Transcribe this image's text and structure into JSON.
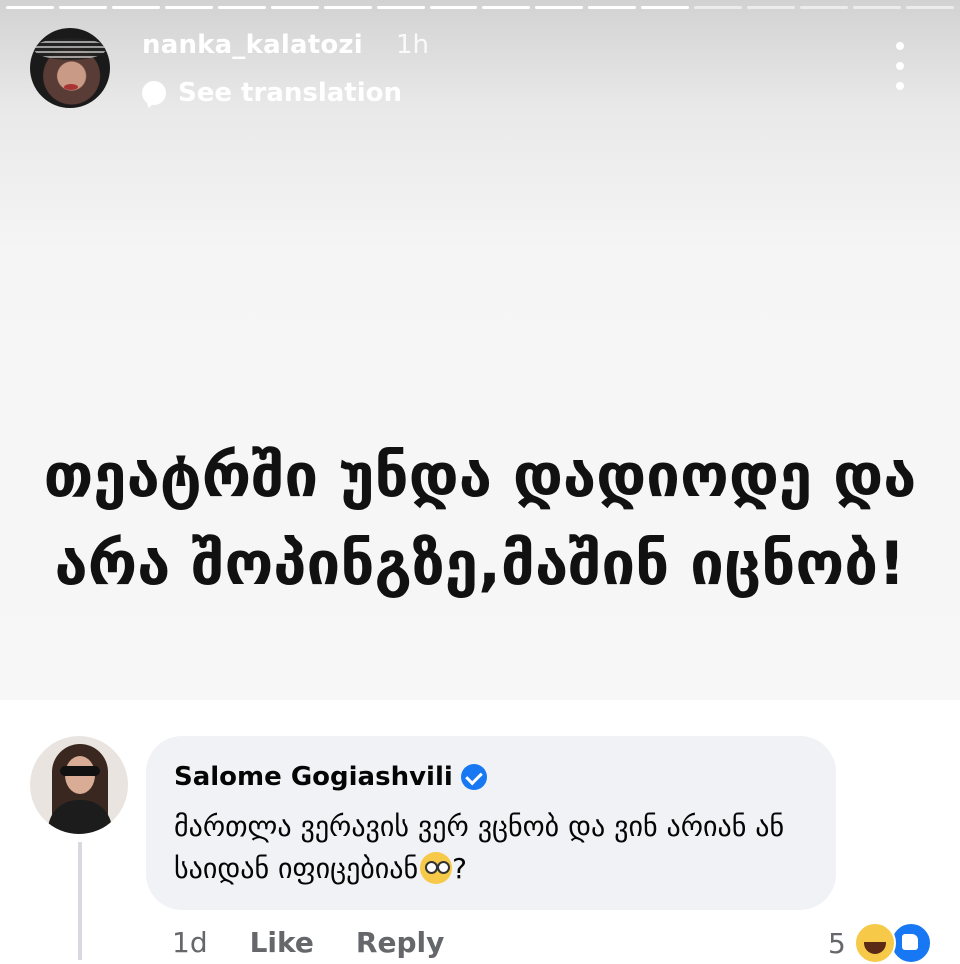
{
  "story": {
    "progress_segments": 18,
    "progress_done": 13,
    "username": "nanka_kalatozi",
    "time": "1h",
    "translate_icon": "speech-bubble-icon",
    "translate_label": "See translation",
    "menu_icon": "more-vertical-icon",
    "text": "თეატრში უნდა დადიოდე და არა შოპინგზე,მაშინ იცნობ!"
  },
  "comment": {
    "author": "Salome Gogiashvili",
    "verified": true,
    "verified_icon": "verified-badge-icon",
    "text": "მართლა ვერავის ვერ ვცნობ და ვინ არიან ან საიდან იფიცებიან",
    "emoji": "flushed-face-icon",
    "text_suffix": "?",
    "time": "1d",
    "like_label": "Like",
    "reply_label": "Reply",
    "reaction_count": "5",
    "reaction_icons": [
      "haha-reaction-icon",
      "like-reaction-icon"
    ]
  },
  "colors": {
    "facebook_blue": "#1877f2",
    "bubble_bg": "#f0f2f5",
    "meta_text": "#65676b"
  }
}
